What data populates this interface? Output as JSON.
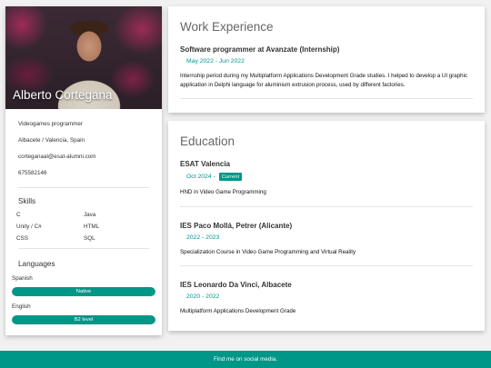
{
  "profile": {
    "name": "Alberto Cortegana",
    "photo_icon": "profile-photo",
    "info": [
      "Videogames programmer",
      "Albacete / Valencia, Spain",
      "corteganaal@esat-alumni.com",
      "675582146"
    ]
  },
  "skills": {
    "title": "Skills",
    "items": [
      "C",
      "Java",
      "Unity / C#",
      "HTML",
      "CSS",
      "SQL"
    ]
  },
  "languages": {
    "title": "Languages",
    "items": [
      {
        "name": "Spanish",
        "level": "Native",
        "fill": 1.0
      },
      {
        "name": "English",
        "level": "B2 level",
        "fill": 1.0
      }
    ]
  },
  "work": {
    "title": "Work Experience",
    "entries": [
      {
        "title": "Software programmer at Avanzate (Internship)",
        "date": "May 2022 - Jun 2022",
        "description": "Internship period during my Multiplatform Applications Development Grade studies. I helped to develop a UI graphic application in Delphi language for aluminium extrusion process, used by different factories."
      }
    ]
  },
  "education": {
    "title": "Education",
    "entries": [
      {
        "title": "ESAT Valencia",
        "date": "Oct 2024 -",
        "badge": "Current",
        "description": "HND in Video Game Programming"
      },
      {
        "title": "IES Paco Mollá, Petrer (Alicante)",
        "date": "2022 - 2023",
        "description": "Specialization Course in Video Game Programming and Virtual Reality"
      },
      {
        "title": "IES Leonardo Da Vinci, Albacete",
        "date": "2020 - 2022",
        "description": "Multiplatform Applications Development Grade"
      }
    ]
  },
  "footer": {
    "text": "Find me on social media."
  },
  "colors": {
    "accent": "#009688",
    "background": "#f1f1f1"
  }
}
